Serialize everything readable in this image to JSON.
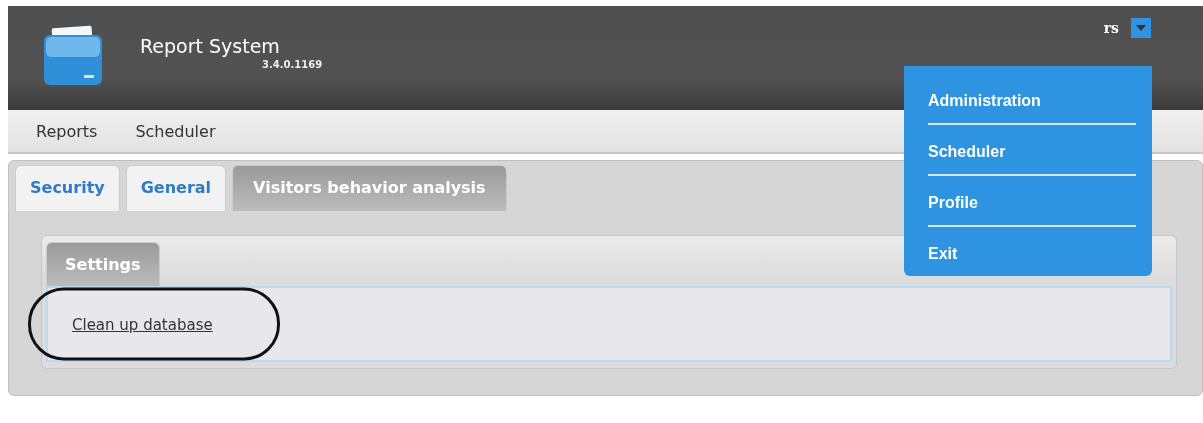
{
  "header": {
    "title": "Report System",
    "version": "3.4.0.1169",
    "user": "rs"
  },
  "nav": [
    {
      "label": "Reports"
    },
    {
      "label": "Scheduler"
    }
  ],
  "user_menu": {
    "expanded": true,
    "items": [
      {
        "label": "Administration"
      },
      {
        "label": "Scheduler"
      },
      {
        "label": "Profile"
      },
      {
        "label": "Exit"
      }
    ]
  },
  "tabs": [
    {
      "label": "Security",
      "selected": false
    },
    {
      "label": "General",
      "selected": false
    },
    {
      "label": "Visitors behavior analysis",
      "selected": true
    }
  ],
  "subtabs": [
    {
      "label": "Settings",
      "selected": true
    }
  ],
  "content": {
    "link": "Clean up database",
    "highlighted": true
  }
}
